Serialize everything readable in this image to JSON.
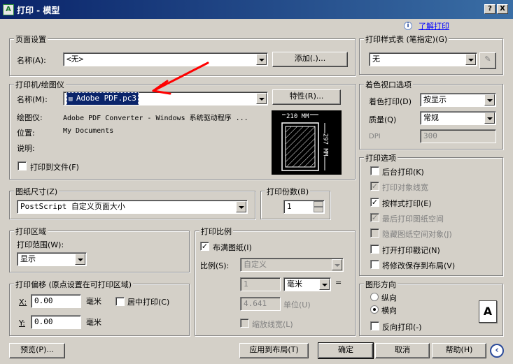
{
  "window": {
    "title": "打印 - 模型",
    "app_icon": "autocad-plot-icon",
    "help_btn": "?",
    "close_btn": "X"
  },
  "help_link": "了解打印",
  "page_setup": {
    "title": "页面设置",
    "name_label": "名称(A):",
    "name_value": "<无>",
    "add_button": "添加(.)..."
  },
  "printer": {
    "title": "打印机/绘图仪",
    "name_label": "名称(M):",
    "name_value": "Adobe PDF.pc3",
    "properties_button": "特性(R)...",
    "plotter_label": "绘图仪:",
    "plotter_value": "Adobe PDF Converter - Windows 系统驱动程序 ...",
    "location_label": "位置:",
    "location_value": "My Documents",
    "description_label": "说明:",
    "print_to_file_label": "打印到文件(F)",
    "preview_width": "210 MM",
    "preview_height": "297 MM"
  },
  "paper_size": {
    "title": "图纸尺寸(Z)",
    "value": "PostScript 自定义页面大小"
  },
  "copies": {
    "title": "打印份数(B)",
    "value": "1"
  },
  "plot_area": {
    "title": "打印区域",
    "range_label": "打印范围(W):",
    "range_value": "显示"
  },
  "plot_offset": {
    "title": "打印偏移 (原点设置在可打印区域)",
    "x_label": "X:",
    "x_value": "0.00",
    "x_unit": "毫米",
    "y_label": "Y:",
    "y_value": "0.00",
    "y_unit": "毫米",
    "center_label": "居中打印(C)"
  },
  "plot_scale": {
    "title": "打印比例",
    "fit_label": "布满图纸(I)",
    "scale_label": "比例(S):",
    "scale_value": "自定义",
    "val1": "1",
    "unit": "毫米",
    "eq": "=",
    "val2": "4.641",
    "unit2_label": "单位(U)",
    "lineweights_label": "缩放线宽(L)"
  },
  "plot_style": {
    "title": "打印样式表 (笔指定)(G)",
    "value": "无"
  },
  "shaded": {
    "title": "着色视口选项",
    "shade_label": "着色打印(D)",
    "shade_value": "按显示",
    "quality_label": "质量(Q)",
    "quality_value": "常规",
    "dpi_label": "DPI",
    "dpi_value": "300"
  },
  "options": {
    "title": "打印选项",
    "items": [
      {
        "label": "后台打印(K)",
        "checked": false,
        "disabled": false
      },
      {
        "label": "打印对象线宽",
        "checked": true,
        "disabled": true
      },
      {
        "label": "按样式打印(E)",
        "checked": true,
        "disabled": false
      },
      {
        "label": "最后打印图纸空间",
        "checked": true,
        "disabled": true
      },
      {
        "label": "隐藏图纸空间对象(J)",
        "checked": false,
        "disabled": true
      },
      {
        "label": "打开打印戳记(N)",
        "checked": false,
        "disabled": false
      },
      {
        "label": "将修改保存到布局(V)",
        "checked": false,
        "disabled": false
      }
    ]
  },
  "orientation": {
    "title": "图形方向",
    "portrait": "纵向",
    "landscape": "横向",
    "reverse": "反向打印(-)",
    "selected": "landscape"
  },
  "footer": {
    "preview": "预览(P)...",
    "apply": "应用到布局(T)",
    "ok": "确定",
    "cancel": "取消",
    "help": "帮助(H)"
  },
  "colors": {
    "title_bar": "#0a246a",
    "selection": "#0a246a",
    "link": "#0000ff",
    "annotation_arrow": "#ff0000"
  }
}
